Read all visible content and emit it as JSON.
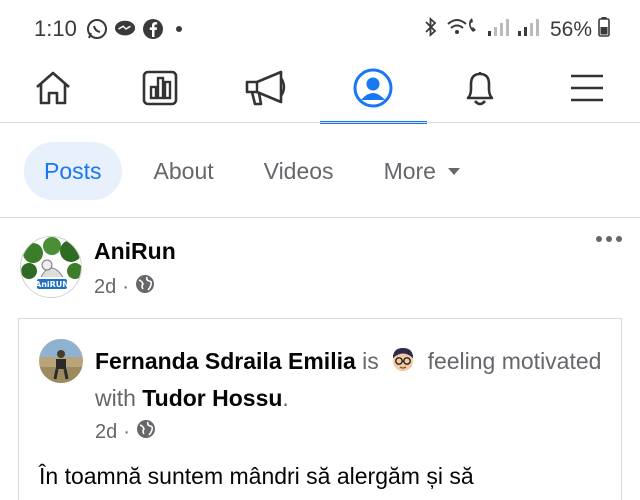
{
  "status_bar": {
    "time": "1:10",
    "battery": "56%",
    "left_icons": [
      "whatsapp-icon",
      "messenger-icon",
      "facebook-icon"
    ],
    "right_icons": [
      "bluetooth-icon",
      "wifi-call-icon",
      "signal-icon",
      "signal-icon",
      "battery-icon"
    ]
  },
  "top_nav": {
    "items": [
      "home-icon",
      "feeds-icon",
      "megaphone-icon",
      "profile-icon",
      "bell-icon",
      "menu-icon"
    ],
    "active": "profile-icon"
  },
  "tabs": {
    "items": [
      {
        "label": "Posts",
        "active": true
      },
      {
        "label": "About",
        "active": false
      },
      {
        "label": "Videos",
        "active": false
      },
      {
        "label": "More",
        "active": false
      }
    ]
  },
  "post": {
    "author": "AniRun",
    "time": "2d",
    "separator": "·",
    "privacy_icon": "globe-icon",
    "avatar_text": "AniRUN",
    "shared": {
      "author": "Fernanda Sdraila Emilia",
      "is_text": "is",
      "feeling_text": "feeling motivated with",
      "with_person": "Tudor Hossu",
      "end_punct": ".",
      "time": "2d",
      "separator": "·",
      "text": "În toamnă suntem mândri să alergăm și să"
    }
  },
  "colors": {
    "accent": "#1877f2",
    "tab_active_bg": "#e7f0fb",
    "secondary_text": "#65676b",
    "divider": "#d9dadd"
  }
}
